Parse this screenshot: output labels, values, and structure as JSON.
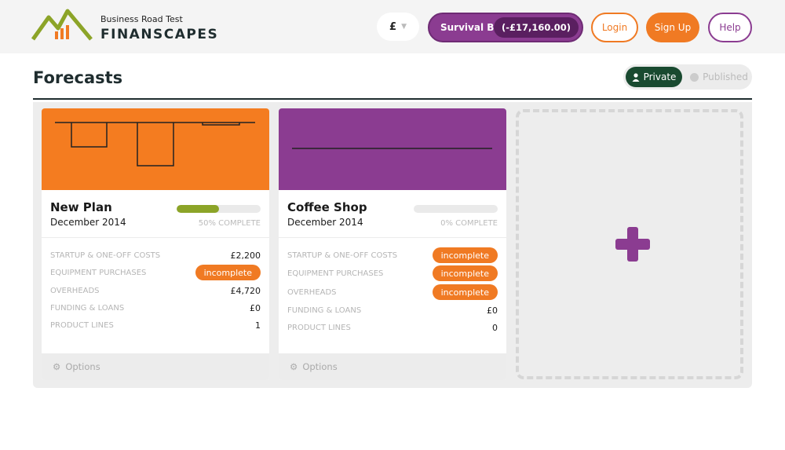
{
  "brand": {
    "tagline": "Business Road Test",
    "name": "FINANSCAPES",
    "colors": {
      "green": "#8ca428",
      "orange": "#f07a23",
      "purple": "#8b3c91",
      "dark": "#1f2d2f"
    }
  },
  "header": {
    "currency": "£",
    "budget_label": "Survival Budget",
    "budget_value": "(-£17,160.00)",
    "login": "Login",
    "signup": "Sign Up",
    "help": "Help"
  },
  "page": {
    "title": "Forecasts",
    "toggle_private": "Private",
    "toggle_published": "Published"
  },
  "cards": [
    {
      "name": "New Plan",
      "date": "December 2014",
      "progress": 0.5,
      "progress_text": "50% COMPLETE",
      "header_color": "#f47c20",
      "rows": [
        {
          "label": "STARTUP & ONE-OFF COSTS",
          "value": "£2,200"
        },
        {
          "label": "EQUIPMENT PURCHASES",
          "value": "incomplete"
        },
        {
          "label": "OVERHEADS",
          "value": "£4,720"
        },
        {
          "label": "FUNDING & LOANS",
          "value": "£0"
        },
        {
          "label": "PRODUCT LINES",
          "value": "1"
        }
      ],
      "options": "Options"
    },
    {
      "name": "Coffee Shop",
      "date": "December 2014",
      "progress": 0,
      "progress_text": "0% COMPLETE",
      "header_color": "#8b3c91",
      "rows": [
        {
          "label": "STARTUP & ONE-OFF COSTS",
          "value": "incomplete"
        },
        {
          "label": "EQUIPMENT PURCHASES",
          "value": "incomplete"
        },
        {
          "label": "OVERHEADS",
          "value": "incomplete"
        },
        {
          "label": "FUNDING & LOANS",
          "value": "£0"
        },
        {
          "label": "PRODUCT LINES",
          "value": "0"
        }
      ],
      "options": "Options"
    }
  ],
  "icons": {
    "logo": "mountain-chart-logo",
    "caret": "chevron-down-icon",
    "user": "user-icon",
    "globe": "globe-icon",
    "gear": "gear-icon",
    "add": "plus-icon"
  }
}
